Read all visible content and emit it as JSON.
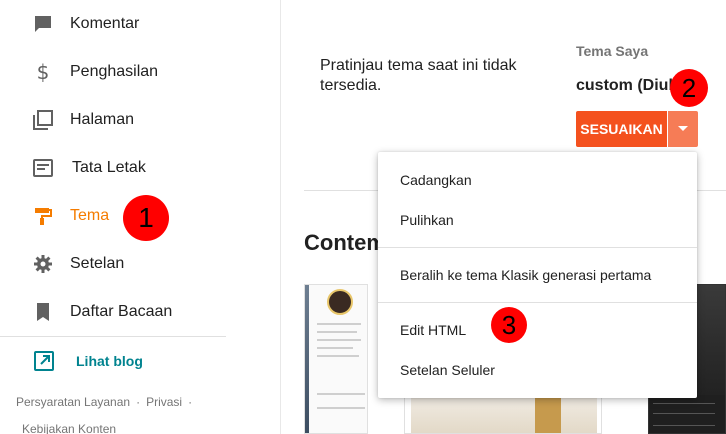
{
  "sidebar": {
    "items": [
      {
        "label": "Komentar",
        "icon": "comment-icon"
      },
      {
        "label": "Penghasilan",
        "icon": "dollar-icon"
      },
      {
        "label": "Halaman",
        "icon": "pages-icon"
      },
      {
        "label": "Tata Letak",
        "icon": "layout-icon"
      },
      {
        "label": "Tema",
        "icon": "paint-roller-icon",
        "active": true
      },
      {
        "label": "Setelan",
        "icon": "gear-icon"
      },
      {
        "label": "Daftar Bacaan",
        "icon": "bookmark-icon"
      }
    ],
    "view_blog": "Lihat blog",
    "footer": {
      "terms": "Persyaratan Layanan",
      "privacy": "Privasi",
      "content_policy": "Kebijakan Konten"
    }
  },
  "main": {
    "preview_message": "Pratinjau tema saat ini tidak tersedia.",
    "my_theme_label": "Tema Saya",
    "theme_name": "custom (Diubah)",
    "customize_button": "SESUAIKAN",
    "section_title": "Contemporary"
  },
  "menu": {
    "items": [
      "Cadangkan",
      "Pulihkan",
      "Beralih ke tema Klasik generasi pertama",
      "Edit HTML",
      "Setelan Seluler"
    ]
  },
  "markers": [
    "1",
    "2",
    "3"
  ],
  "colors": {
    "accent": "#f57c00",
    "button": "#f4511e",
    "link": "#00838f",
    "marker": "#ff0000"
  }
}
